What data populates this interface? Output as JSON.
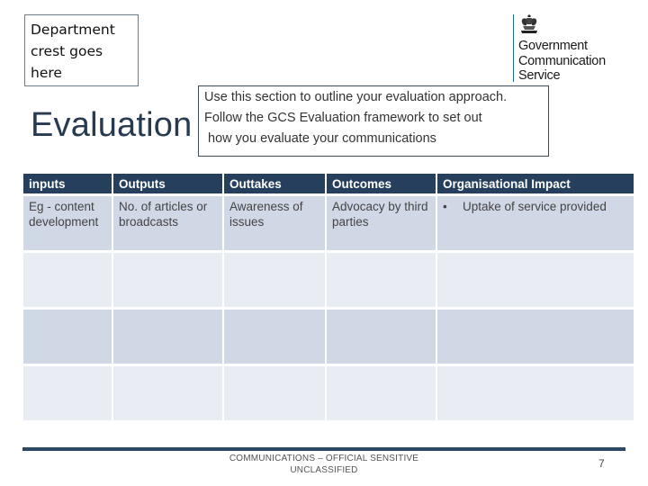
{
  "header": {
    "crest_placeholder_lines": [
      "Department",
      "crest goes",
      "here"
    ],
    "logo": {
      "icon": "royal-coat-of-arms-icon",
      "lines": [
        "Government",
        "Communication",
        "Service"
      ],
      "rule_color": "#2b6d99"
    },
    "title": "Evaluation",
    "instructions_lines": [
      "Use this section to outline your evaluation approach.",
      "Follow the GCS Evaluation framework to set out",
      " how you evaluate your communications"
    ]
  },
  "table": {
    "header_color": "#263f5c",
    "columns": [
      "inputs",
      "Outputs",
      "Outtakes",
      "Outcomes",
      "Organisational Impact"
    ],
    "rows": [
      {
        "cells": [
          "Eg -  content development",
          "No. of articles or broadcasts",
          "Awareness of issues",
          "Advocacy by third parties",
          ""
        ],
        "bullet": "•",
        "bullet_text": "Uptake of service provided"
      },
      {
        "cells": [
          "",
          "",
          "",
          "",
          ""
        ]
      },
      {
        "cells": [
          "",
          "",
          "",
          "",
          ""
        ]
      },
      {
        "cells": [
          "",
          "",
          "",
          "",
          ""
        ]
      }
    ]
  },
  "footer": {
    "classification_lines": [
      "COMMUNICATIONS – OFFICIAL SENSITIVE",
      "UNCLASSIFIED"
    ],
    "page_number": "7"
  }
}
